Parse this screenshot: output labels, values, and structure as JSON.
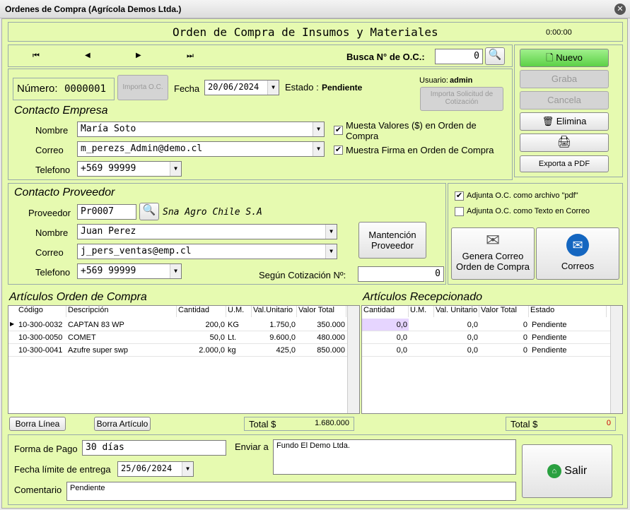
{
  "window": {
    "title": "Ordenes de Compra (Agrícola Demos Ltda.)"
  },
  "header": {
    "title": "Orden de Compra de Insumos y Materiales",
    "time": "0:00:00"
  },
  "nav": {
    "search_label": "Busca N° de O.C.:",
    "search_value": "0"
  },
  "actions": {
    "nuevo": "Nuevo",
    "graba": "Graba",
    "cancela": "Cancela",
    "elimina": "Elimina",
    "exporta": "Exporta a PDF"
  },
  "order": {
    "numero_label": "Número:",
    "numero": "0000001",
    "importa_oc": "Importa O.C.",
    "fecha_label": "Fecha",
    "fecha": "20/06/2024",
    "estado_label": "Estado :",
    "estado": "Pendiente",
    "usuario_label": "Usuario:",
    "usuario": "admin",
    "importa_solicitud": "Importa Solicitud de Cotización"
  },
  "empresa": {
    "section": "Contacto Empresa",
    "nombre_label": "Nombre",
    "nombre": "María Soto",
    "correo_label": "Correo",
    "correo": "m_perezs_Admin@demo.cl",
    "telefono_label": "Telefono",
    "telefono": "+569 99999",
    "muestra_valores": "Muesta Valores ($) en Orden de Compra",
    "muestra_firma": "Muestra Firma en Orden de Compra"
  },
  "proveedor": {
    "section": "Contacto Proveedor",
    "proveedor_label": "Proveedor",
    "codigo": "Pr0007",
    "razon": "Sna Agro Chile S.A",
    "nombre_label": "Nombre",
    "nombre": "Juan Perez",
    "correo_label": "Correo",
    "correo": "j_pers_ventas@emp.cl",
    "telefono_label": "Telefono",
    "telefono": "+569 99999",
    "mantencion": "Mantención Proveedor",
    "cotizacion_label": "Según Cotización Nº:",
    "cotizacion": "0"
  },
  "email": {
    "adjunta_pdf": "Adjunta O.C. como archivo \"pdf\"",
    "adjunta_texto": "Adjunta O.C. como Texto en Correo",
    "genera": "Genera Correo Orden de Compra",
    "correos": "Correos"
  },
  "articulos": {
    "section": "Artículos Orden de Compra",
    "headers": [
      "Código",
      "Descripción",
      "Cantidad",
      "U.M.",
      "Val.Unitario",
      "Valor Total"
    ],
    "rows": [
      [
        "10-300-0032",
        "CAPTAN 83 WP",
        "200,0",
        "KG",
        "1.750,0",
        "350.000"
      ],
      [
        "10-300-0050",
        "COMET",
        "50,0",
        "Lt.",
        "9.600,0",
        "480.000"
      ],
      [
        "10-300-0041",
        "Azufre super swp",
        "2.000,0",
        "kg",
        "425,0",
        "850.000"
      ]
    ],
    "borra_linea": "Borra Línea",
    "borra_articulo": "Borra Artículo",
    "total_label": "Total $",
    "total": "1.680.000"
  },
  "recepcion": {
    "section": "Artículos Recepcionado",
    "headers": [
      "Cantidad",
      "U.M.",
      "Val. Unitario",
      "Valor Total",
      "Estado"
    ],
    "rows": [
      [
        "0,0",
        "",
        "0,0",
        "0",
        "Pendiente"
      ],
      [
        "0,0",
        "",
        "0,0",
        "0",
        "Pendiente"
      ],
      [
        "0,0",
        "",
        "0,0",
        "0",
        "Pendiente"
      ]
    ],
    "total_label": "Total $",
    "total": "0"
  },
  "footer": {
    "forma_pago_label": "Forma de Pago",
    "forma_pago": "30 días",
    "fecha_limite_label": "Fecha límite de entrega",
    "fecha_limite": "25/06/2024",
    "comentario_label": "Comentario",
    "comentario": "Pendiente",
    "enviar_label": "Enviar a",
    "enviar": "Fundo El Demo Ltda.",
    "salir": "Salir"
  }
}
